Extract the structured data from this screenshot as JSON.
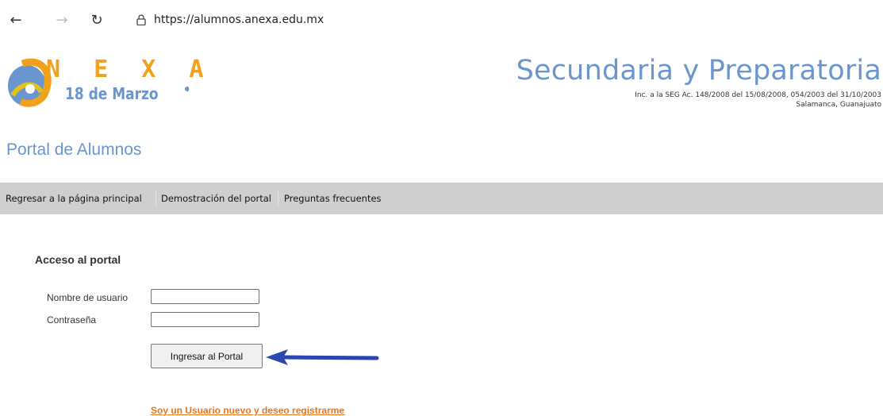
{
  "browser": {
    "back_icon": "←",
    "forward_icon": "→",
    "reload_icon": "↻",
    "url": "https://alumnos.anexa.edu.mx"
  },
  "header": {
    "logo_letters": "N E X A",
    "logo_subtitle": "18 de Marzo",
    "site_title": "Secundaria y Preparatoria",
    "accreditation": "Inc. a la SEG Ac. 148/2008 del 15/08/2008, 054/2003 del 31/10/2003",
    "location": "Salamanca, Guanajuato",
    "brand_blue": "#6a96cf"
  },
  "page": {
    "title": "Portal de Alumnos"
  },
  "menu": {
    "items": [
      {
        "label": "Regresar a la página principal"
      },
      {
        "label": "Demostración del portal"
      },
      {
        "label": "Preguntas frecuentes"
      }
    ]
  },
  "login": {
    "section_title": "Acceso al portal",
    "username_label": "Nombre de usuario",
    "username_value": "",
    "password_label": "Contraseña",
    "password_value": "",
    "submit_label": "Ingresar al Portal",
    "register_link": "Soy un Usuario nuevo y deseo registrarme"
  },
  "colors": {
    "menu_bg": "#cfcfcf",
    "link_orange": "#e8761f",
    "arrow_blue": "#2b46b0"
  }
}
